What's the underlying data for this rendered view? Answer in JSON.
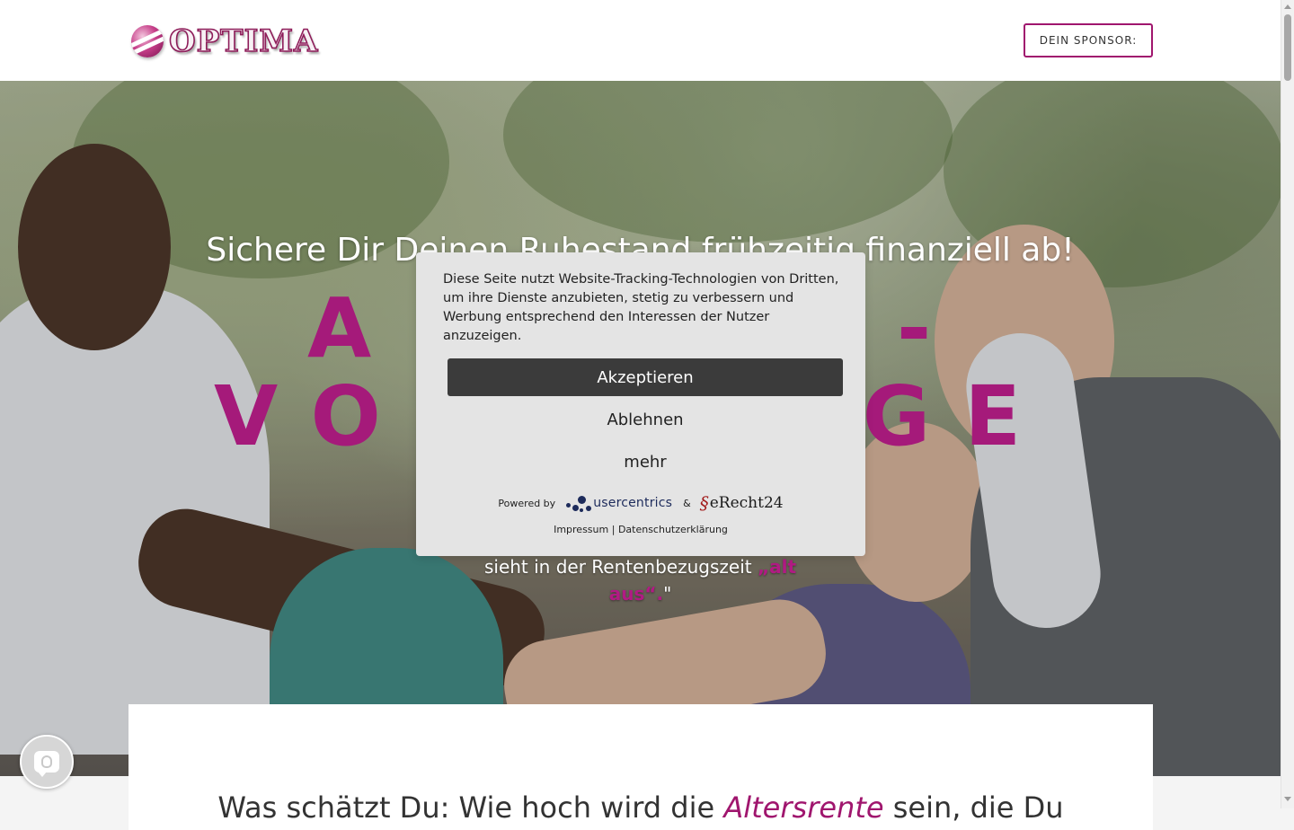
{
  "header": {
    "logo_text": "OPTIMA",
    "sponsor_button": "DEIN SPONSOR:"
  },
  "hero": {
    "title": "Sichere Dir Deinen Ruhestand frühzeitig finanziell ab!",
    "big_word_line1": "A",
    "big_word_dash": "-",
    "big_word_line2_left": "VO",
    "big_word_line2_right": "GE",
    "subtitle_text": "sieht in der Rentenbezugszeit ",
    "subtitle_accent": "„alt aus“.",
    "subtitle_end": "\""
  },
  "consent": {
    "text": "Diese Seite nutzt Website-Tracking-Technologien von Dritten, um ihre Dienste anzubieten, stetig zu verbessern und Werbung entsprechend den Interessen der Nutzer anzuzeigen.",
    "accept": "Akzeptieren",
    "decline": "Ablehnen",
    "more": "mehr",
    "powered_by": "Powered by",
    "usercentrics": "usercentrics",
    "ampersand": "&",
    "erecht": "eRecht24",
    "impressum": "Impressum",
    "separator": "|",
    "datenschutz": "Datenschutzerklärung"
  },
  "content": {
    "heading_start": "Was schätzt Du: Wie hoch wird die ",
    "heading_accent": "Altersrente",
    "heading_end": " sein, die Du"
  },
  "colors": {
    "brand": "#a0166e",
    "accent_text": "#a51a7a",
    "accept_bg": "#3b3b3b",
    "modal_bg": "#e4e4e4"
  },
  "icons": {
    "privacy": "fingerprint-chat-icon",
    "logo": "optima-sphere-icon"
  }
}
